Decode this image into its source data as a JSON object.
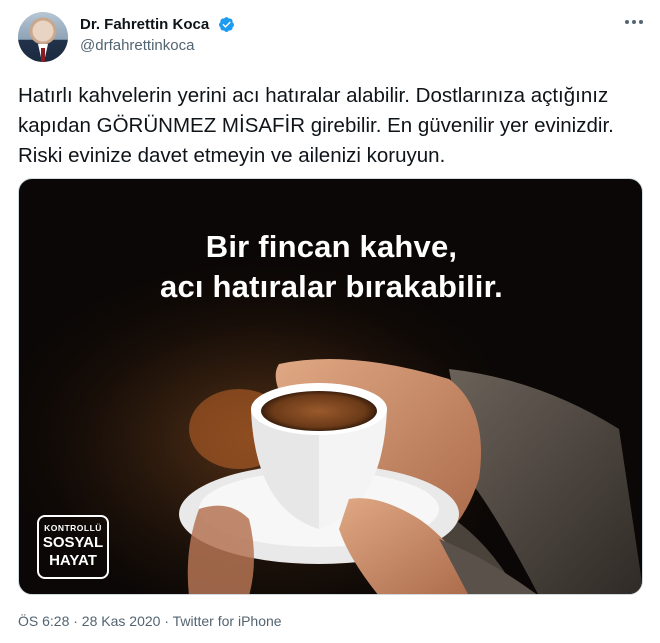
{
  "user": {
    "display_name": "Dr. Fahrettin Koca",
    "handle": "@drfahrettinkoca",
    "verified": true
  },
  "tweet": {
    "text": "Hatırlı kahvelerin yerini acı hatıralar alabilir. Dostlarınıza açtığınız kapıdan GÖRÜNMEZ MİSAFİR girebilir. En güvenilir yer evinizdir. Riski evinize davet etmeyin ve ailenizi koruyun."
  },
  "media": {
    "headline_line1": "Bir fincan kahve,",
    "headline_line2": "acı hatıralar bırakabilir.",
    "badge_line1": "KONTROLLÜ",
    "badge_line2": "SOSYAL",
    "badge_line3": "HAYAT"
  },
  "meta": {
    "text": "ÖS 6:28 · 28 Kas 2020 · Twitter for iPhone"
  },
  "icons": {
    "verified": "verified-badge-icon",
    "more": "more-options-icon"
  },
  "colors": {
    "accent": "#1d9bf0",
    "text": "#0f1419",
    "secondary": "#536471"
  }
}
